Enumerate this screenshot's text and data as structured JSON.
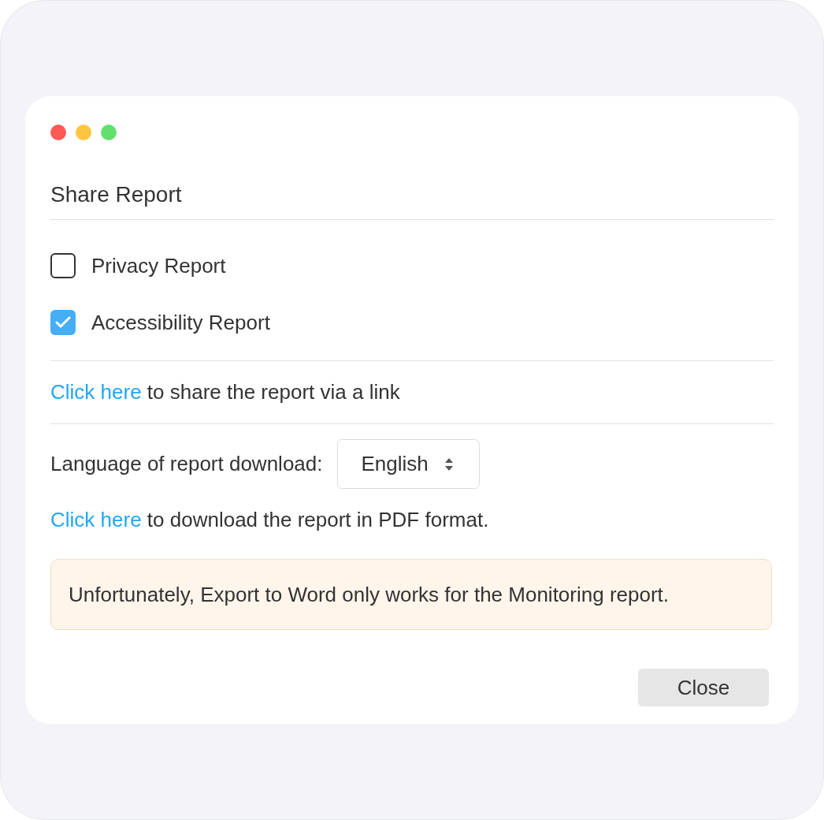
{
  "window": {
    "controls": [
      {
        "color": "#fd5a56"
      },
      {
        "color": "#fec53f"
      },
      {
        "color": "#63e06b"
      }
    ]
  },
  "title": "Share Report",
  "reports": [
    {
      "label": "Privacy Report",
      "checked": false
    },
    {
      "label": "Accessibility Report",
      "checked": true
    }
  ],
  "share": {
    "link": "Click here",
    "text": "to share the report via a link"
  },
  "language": {
    "label": "Language of report download:",
    "value": "English"
  },
  "download": {
    "link": "Click here",
    "text": "to download the report in PDF format."
  },
  "notice": "Unfortunately, Export to Word only works for the Monitoring report.",
  "buttons": [
    "Close"
  ]
}
